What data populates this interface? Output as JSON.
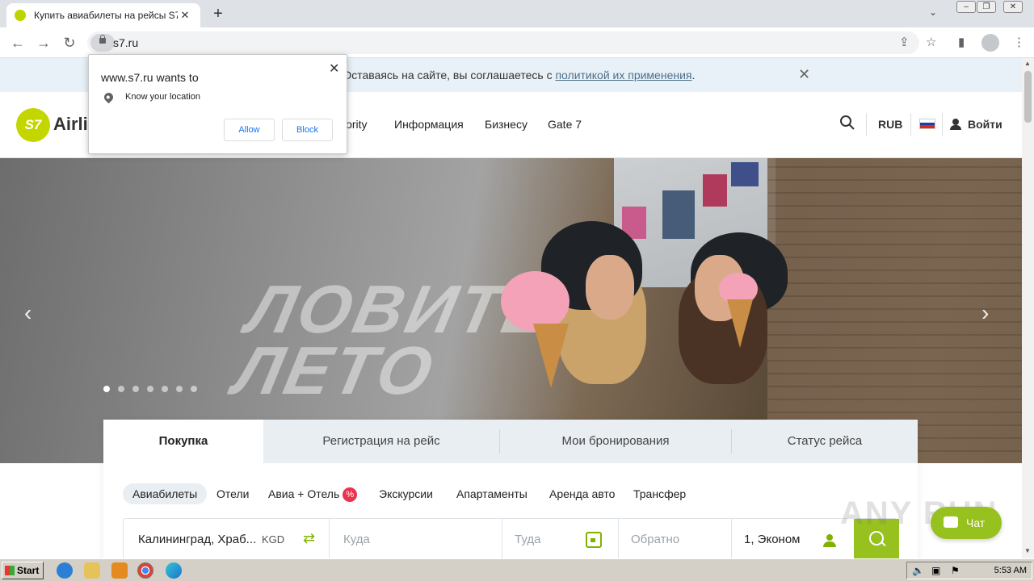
{
  "browser": {
    "tab_title": "Купить авиабилеты на рейсы S7 А",
    "new_tab": "+",
    "url": "s7.ru"
  },
  "permission": {
    "title": "www.s7.ru wants to",
    "item": "Know your location",
    "allow": "Allow",
    "block": "Block"
  },
  "cookie": {
    "text": "мы используем куки. Оставаясь на сайте, вы соглашаетесь с ",
    "link": "политикой их применения",
    "suffix": "."
  },
  "header": {
    "logo_mark": "S7",
    "logo_text": "Airli",
    "nav": [
      "iority",
      "Информация",
      "Бизнесу",
      "Gate 7"
    ],
    "currency": "RUB",
    "login": "Войти"
  },
  "hero": {
    "overlay_text": "ЛОВИТЕ ЛЕТО",
    "slide_count": 7,
    "active_slide": 1
  },
  "booking": {
    "tabs": [
      "Покупка",
      "Регистрация на рейс",
      "Мои бронирования",
      "Статус рейса"
    ],
    "categories": [
      "Авиабилеты",
      "Отели",
      "Авиа + Отель",
      "Экскурсии",
      "Апартаменты",
      "Аренда авто",
      "Трансфер"
    ],
    "badge": "%",
    "from_value": "Калининград, Храб...",
    "from_code": "KGD",
    "to_placeholder": "Куда",
    "depart_placeholder": "Туда",
    "return_placeholder": "Обратно",
    "passengers": "1, Эконом"
  },
  "chat": {
    "label": "Чат"
  },
  "watermark": "ANY RUN",
  "taskbar": {
    "start": "Start",
    "clock": "5:53 AM"
  },
  "colors": {
    "accent": "#96c11f",
    "badge": "#e8344e"
  }
}
